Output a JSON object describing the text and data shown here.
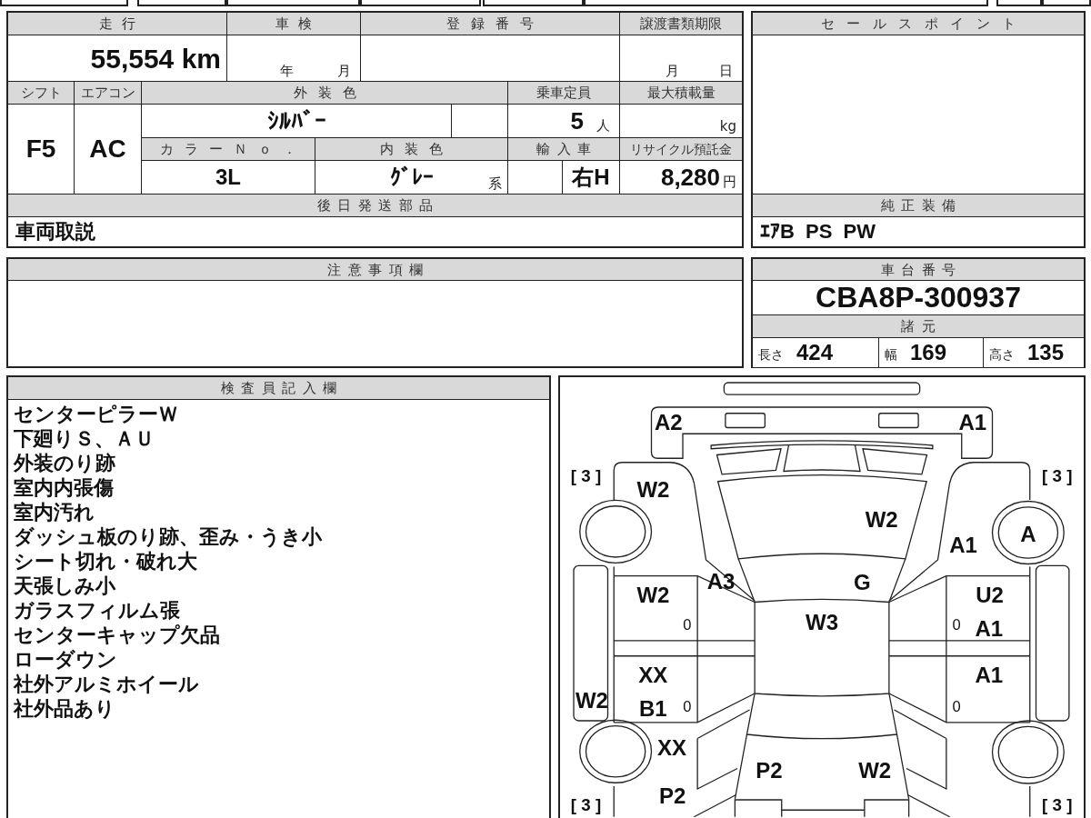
{
  "vehicle_table": {
    "mileage": {
      "label": "走行",
      "value": "55,554 km"
    },
    "inspection": {
      "label": "車検",
      "year_unit": "年",
      "month_unit": "月"
    },
    "registration_number": {
      "label": "登録番号"
    },
    "transfer_deadline": {
      "label": "譲渡書類期限",
      "month_unit": "月",
      "day_unit": "日"
    },
    "shift": {
      "label": "シフト",
      "value": "F5"
    },
    "air_conditioner": {
      "label": "エアコン",
      "value": "AC"
    },
    "exterior_color": {
      "label": "外装色",
      "value": "ｼﾙﾊﾞｰ"
    },
    "capacity": {
      "label": "乗車定員",
      "value": "5",
      "unit": "人"
    },
    "max_load": {
      "label": "最大積載量",
      "unit": "kg"
    },
    "color_number": {
      "label": "カラーＮｏ．",
      "value": "3L"
    },
    "interior_color": {
      "label": "内装色",
      "value": "ｸﾞﾚｰ",
      "suffix": "系"
    },
    "import": {
      "label": "輸入車",
      "value": "右H"
    },
    "recycle_deposit": {
      "label": "リサイクル預託金",
      "value": "8,280",
      "unit": "円"
    },
    "later_shipped_parts": {
      "label": "後日発送部品",
      "value": "車両取説"
    }
  },
  "sales_points": {
    "label": "セールスポイント"
  },
  "standard_equipment": {
    "label": "純正装備",
    "value": "ｴｱB PS PW"
  },
  "caution_notes": {
    "label": "注意事項欄"
  },
  "chassis_number": {
    "label": "車台番号",
    "value": "CBA8P-300937"
  },
  "specs": {
    "label": "諸元",
    "items": [
      {
        "label": "長さ",
        "value": "424"
      },
      {
        "label": "幅",
        "value": "169"
      },
      {
        "label": "高さ",
        "value": "135"
      }
    ]
  },
  "inspector_notes": {
    "label": "検査員記入欄",
    "lines": [
      "センターピラーＷ",
      "下廻りＳ、ＡＵ",
      "外装のり跡",
      "室内内張傷",
      "室内汚れ",
      "ダッシュ板のり跡、歪み・うき小",
      "シート切れ・破れ大",
      "天張しみ小",
      "ガラスフィルム張",
      "センターキャップ欠品",
      "ローダウン",
      "社外アルミホイール",
      "社外品あり"
    ]
  },
  "condition_diagram": {
    "tread_marks": [
      "[ 3 ]",
      "[ 3 ]",
      "[ 3 ]",
      "[ 3 ]"
    ],
    "damage_codes": [
      "A2",
      "A1",
      "W2",
      "W2",
      "A",
      "A1",
      "G",
      "A3",
      "W2",
      "U2",
      "W3",
      "A1",
      "XX",
      "A1",
      "W2",
      "B1",
      "XX",
      "P2",
      "W2",
      "P2"
    ],
    "small_marks": [
      "0",
      "0",
      "0",
      "0"
    ]
  }
}
